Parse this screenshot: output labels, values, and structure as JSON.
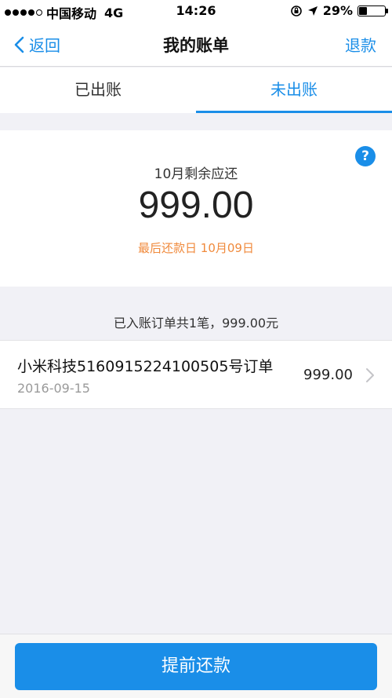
{
  "status_bar": {
    "carrier": "中国移动",
    "network": "4G",
    "time": "14:26",
    "battery_percent_text": "29%",
    "battery_level": 0.29,
    "signal_bars_filled": 4,
    "signal_bars_total": 5
  },
  "nav": {
    "back_label": "返回",
    "title": "我的账单",
    "refund_label": "退款"
  },
  "tabs": [
    {
      "label": "已出账",
      "active": false
    },
    {
      "label": "未出账",
      "active": true
    }
  ],
  "summary": {
    "label": "10月剩余应还",
    "amount": "999.00",
    "due_text": "最后还款日 10月09日",
    "help_label": "?"
  },
  "orders": {
    "summary_text": "已入账订单共1笔，999.00元",
    "items": [
      {
        "title": "小米科技5160915224100505号订单",
        "date": "2016-09-15",
        "amount": "999.00"
      }
    ]
  },
  "footer": {
    "repay_button_label": "提前还款"
  },
  "colors": {
    "accent": "#1a8ee8",
    "due_text": "#f08a3c",
    "background": "#f1f1f6"
  }
}
